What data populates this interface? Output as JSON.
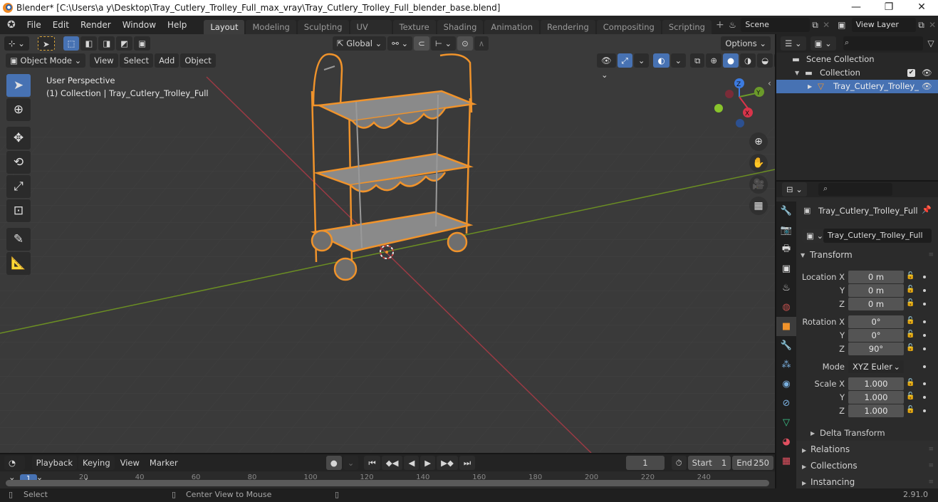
{
  "window": {
    "title": "Blender* [C:\\Users\\a y\\Desktop\\Tray_Cutlery_Trolley_Full_max_vray\\Tray_Cutlery_Trolley_Full_blender_base.blend]",
    "controls": {
      "minimize": "—",
      "maximize": "❐",
      "close": "✕"
    }
  },
  "menubar": {
    "menus": [
      "File",
      "Edit",
      "Render",
      "Window",
      "Help"
    ],
    "workspaces": [
      "Layout",
      "Modeling",
      "Sculpting",
      "UV Editing",
      "Texture Paint",
      "Shading",
      "Animation",
      "Rendering",
      "Compositing",
      "Scripting"
    ],
    "active_workspace": "Layout",
    "add_tab": "+",
    "scene": "Scene",
    "view_layer": "View Layer"
  },
  "viewport": {
    "mode": "Object Mode",
    "menus": [
      "View",
      "Select",
      "Add",
      "Object"
    ],
    "transform_orientation": "Global",
    "options_label": "Options",
    "overlay_line1": "User Perspective",
    "overlay_line2": "(1) Collection | Tray_Cutlery_Trolley_Full",
    "gizmo": {
      "x": "X",
      "y": "Y",
      "z": "Z"
    },
    "colors": {
      "background": "#3a3a3a",
      "selection_outline": "#f0932b",
      "x_axis": "#9b3a44",
      "y_axis": "#6b8e23"
    },
    "tools": [
      "select-box",
      "cursor",
      "move",
      "rotate",
      "scale",
      "transform",
      "annotate",
      "measure"
    ],
    "nav_buttons": [
      "zoom",
      "pan",
      "camera",
      "ortho-grid"
    ]
  },
  "outliner": {
    "search_placeholder": "",
    "rows": [
      {
        "label": "Scene Collection",
        "icon": "scene-collection-icon"
      },
      {
        "label": "Collection",
        "icon": "collection-icon",
        "checked": true
      },
      {
        "label": "Tray_Cutlery_Trolley_",
        "icon": "mesh-icon",
        "selected": true
      }
    ]
  },
  "properties": {
    "object_name": "Tray_Cutlery_Trolley_Full",
    "datablock_name": "Tray_Cutlery_Trolley_Full",
    "transform_label": "Transform",
    "location": {
      "label": "Location X",
      "x": "0 m",
      "y": "0 m",
      "z": "0 m"
    },
    "rotation": {
      "label": "Rotation X",
      "x": "0°",
      "y": "0°",
      "z": "90°"
    },
    "mode": {
      "label": "Mode",
      "value": "XYZ Euler"
    },
    "scale": {
      "label": "Scale X",
      "x": "1.000",
      "y": "1.000",
      "z": "1.000"
    },
    "axis_labels": {
      "y": "Y",
      "z": "Z"
    },
    "subsections": [
      "Delta Transform",
      "Relations",
      "Collections",
      "Instancing"
    ]
  },
  "timeline": {
    "menus": [
      "Playback",
      "Keying",
      "View",
      "Marker"
    ],
    "current_frame": "1",
    "start_label": "Start",
    "start": "1",
    "end_label": "End",
    "end": "250",
    "ticks": [
      "1",
      "20",
      "40",
      "60",
      "80",
      "100",
      "120",
      "140",
      "160",
      "180",
      "200",
      "220",
      "240"
    ]
  },
  "statusbar": {
    "left": "Select",
    "middle": "Center View to Mouse",
    "version": "2.91.0"
  }
}
